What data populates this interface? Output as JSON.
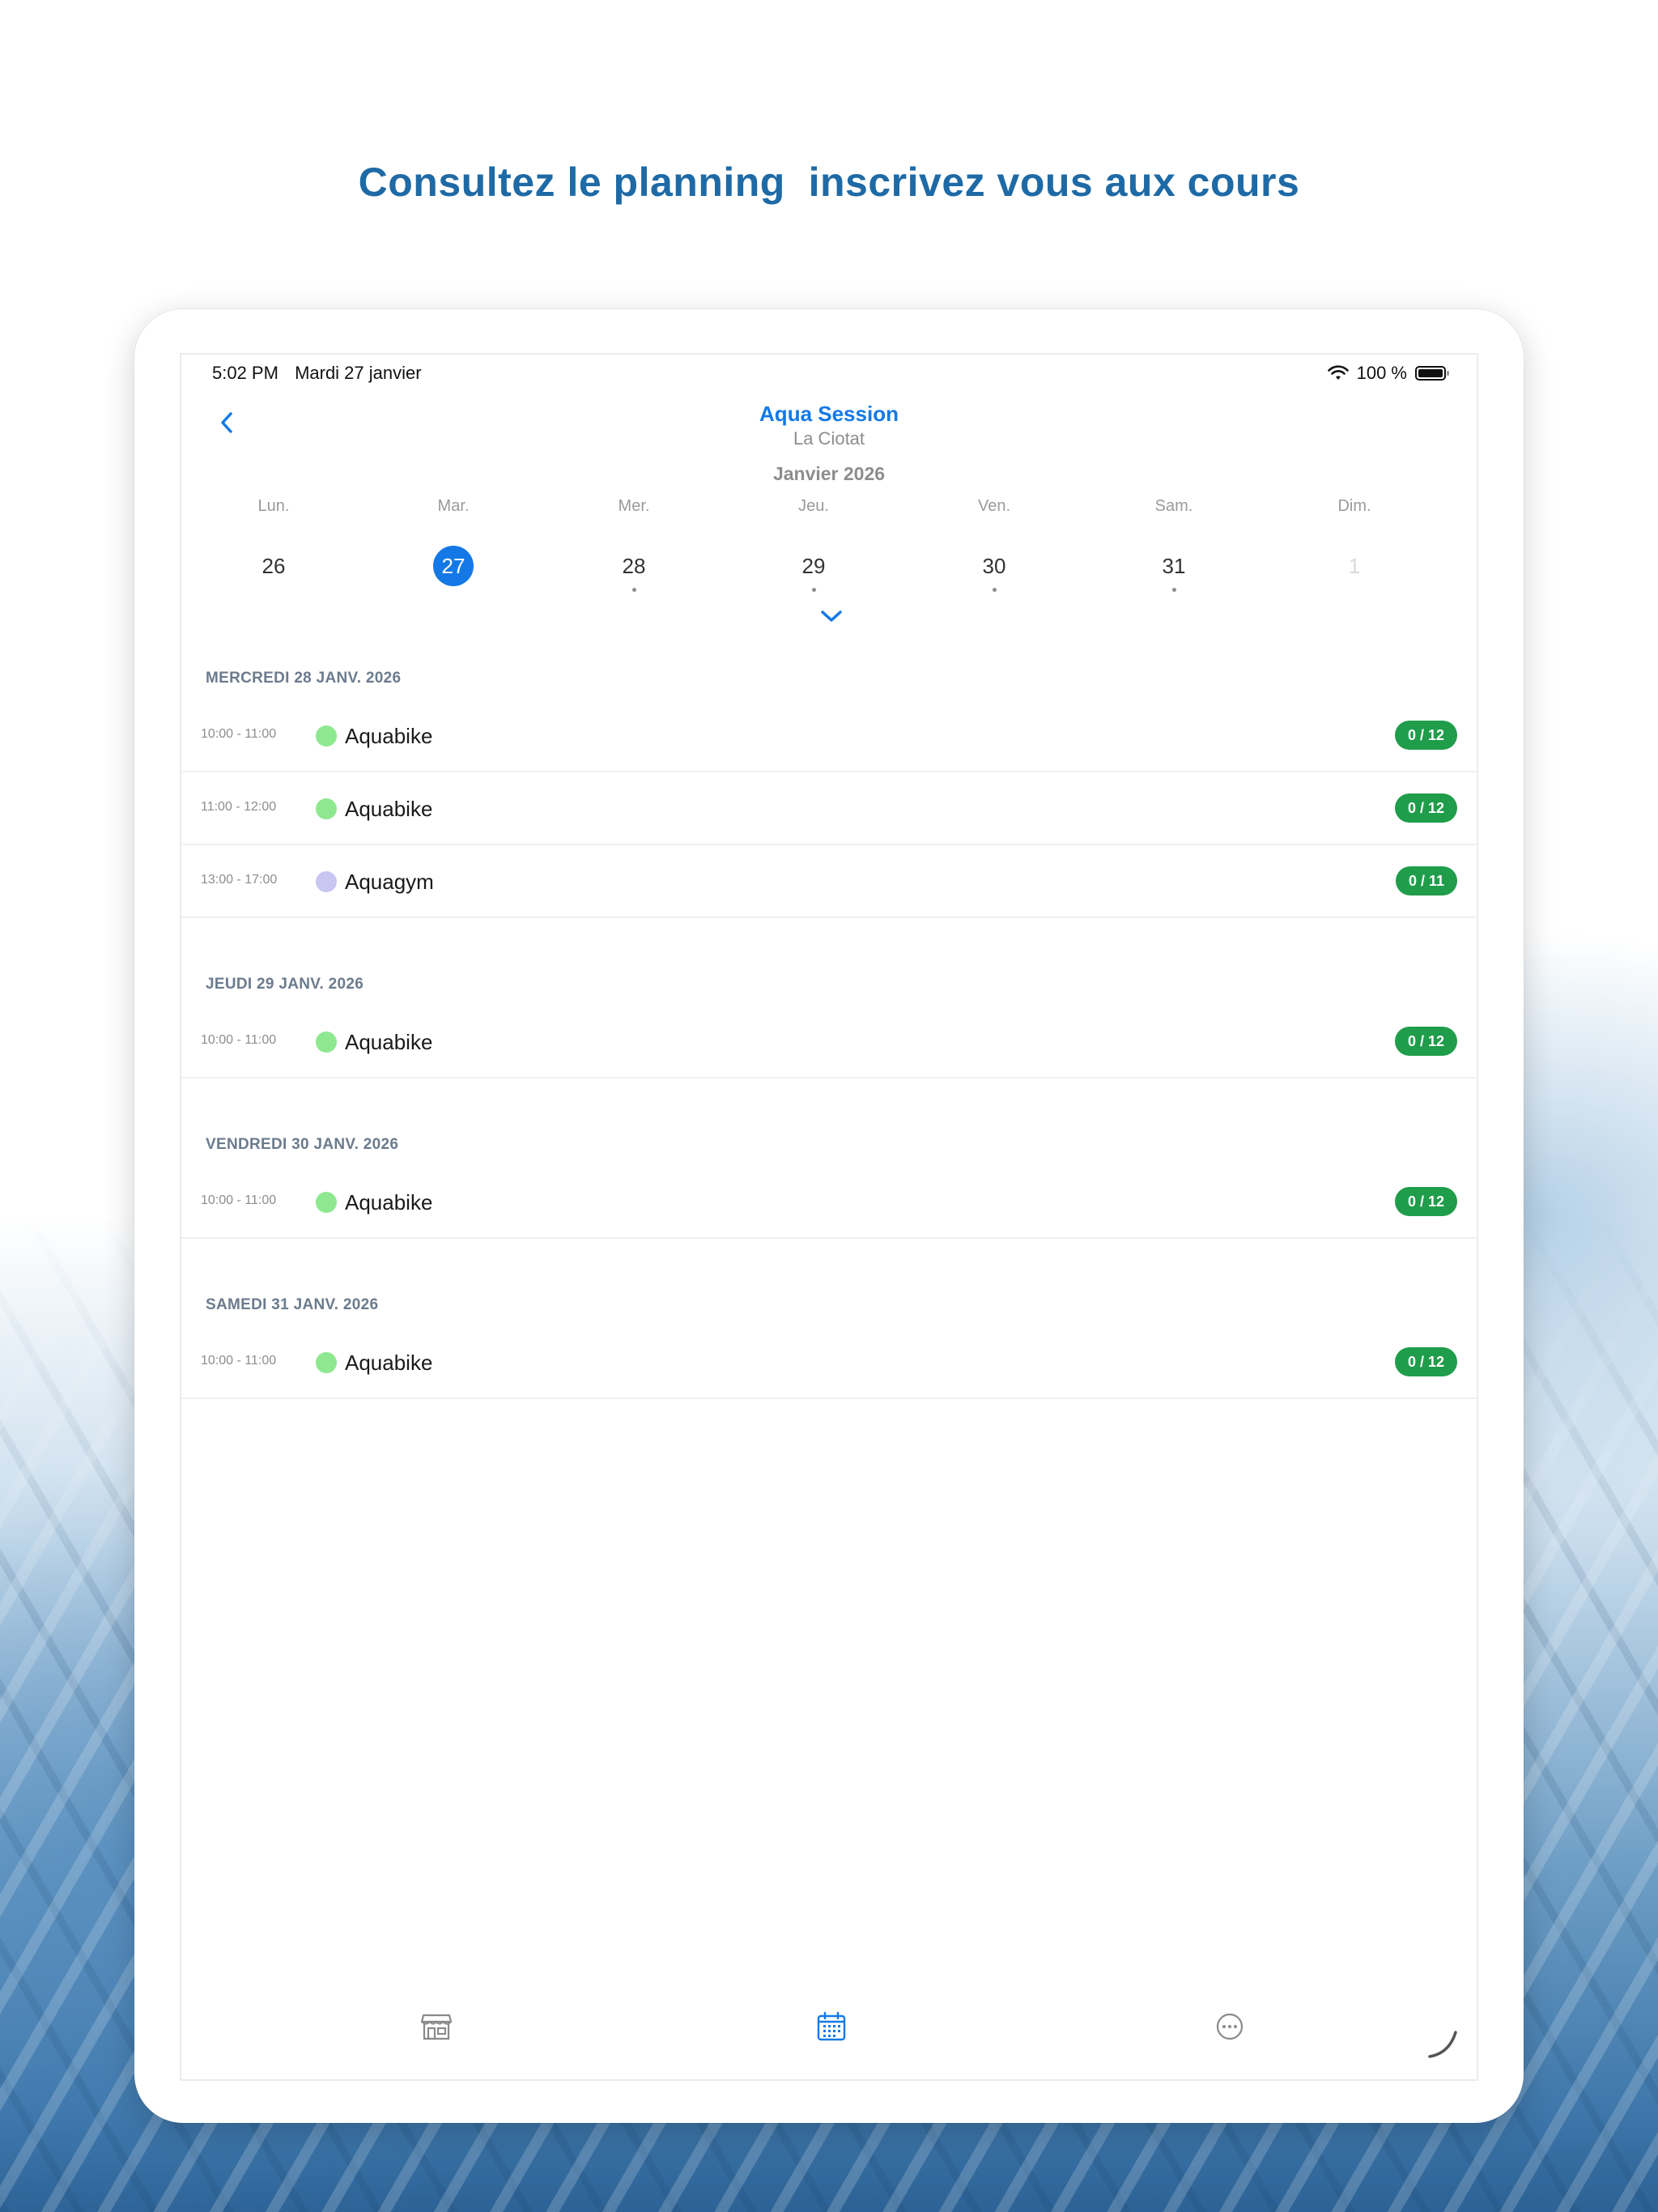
{
  "headline": "Consultez le planning  inscrivez vous aux cours",
  "status_bar": {
    "time": "5:02 PM",
    "date": "Mardi 27 janvier",
    "battery": "100 %"
  },
  "nav": {
    "title": "Aqua Session",
    "subtitle": "La Ciotat"
  },
  "calendar": {
    "month": "Janvier 2026",
    "days": [
      {
        "name": "Lun.",
        "num": "26"
      },
      {
        "name": "Mar.",
        "num": "27"
      },
      {
        "name": "Mer.",
        "num": "28"
      },
      {
        "name": "Jeu.",
        "num": "29"
      },
      {
        "name": "Ven.",
        "num": "30"
      },
      {
        "name": "Sam.",
        "num": "31"
      },
      {
        "name": "Dim.",
        "num": "1"
      }
    ],
    "selected_day": "27"
  },
  "sections": [
    {
      "title": "MERCREDI 28 JANV. 2026",
      "items": [
        {
          "time": "10:00 - 11:00",
          "name": "Aquabike",
          "spots": "0 / 12"
        },
        {
          "time": "11:00 - 12:00",
          "name": "Aquabike",
          "spots": "0 / 12"
        },
        {
          "time": "13:00 - 17:00",
          "name": "Aquagym",
          "spots": "0 / 11"
        }
      ]
    },
    {
      "title": "JEUDI 29 JANV. 2026",
      "items": [
        {
          "time": "10:00 - 11:00",
          "name": "Aquabike",
          "spots": "0 / 12"
        }
      ]
    },
    {
      "title": "VENDREDI 30 JANV. 2026",
      "items": [
        {
          "time": "10:00 - 11:00",
          "name": "Aquabike",
          "spots": "0 / 12"
        }
      ]
    },
    {
      "title": "SAMEDI 31 JANV. 2026",
      "items": [
        {
          "time": "10:00 - 11:00",
          "name": "Aquabike",
          "spots": "0 / 12"
        }
      ]
    }
  ],
  "colors": {
    "accent": "#1479e6",
    "headline": "#1e6aa6",
    "badge": "#1f9d4a",
    "aquabike": "#8ee88f",
    "aquagym": "#c9c6f2"
  },
  "tabbar": {
    "tabs": [
      "store-icon",
      "calendar-icon",
      "more-icon"
    ],
    "active": "calendar-icon"
  }
}
